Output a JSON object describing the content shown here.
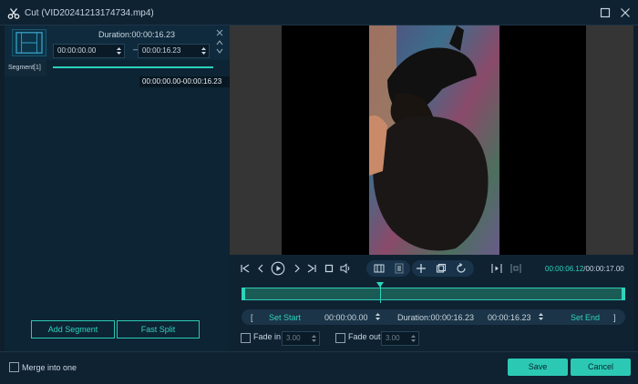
{
  "window": {
    "title": "Cut (VID20241213174734.mp4)",
    "icons": {
      "app": "scissors-icon",
      "maximize": "maximize-icon",
      "close": "close-icon"
    }
  },
  "segment_panel": {
    "duration_text": "Duration:00:00:16.23",
    "start_time": "00:00:00.00",
    "end_time": "00:00:16.23",
    "segment_label": "Segment[1]",
    "segment_range": "00:00:00.00-00:00:16.23",
    "add_segment_label": "Add Segment",
    "fast_split_label": "Fast Split"
  },
  "player": {
    "current_time": "00:00:06.12",
    "total_time": "/00:00:17.00",
    "playhead_fraction": 0.36
  },
  "trim_bar": {
    "open_bracket": "[",
    "set_start_label": "Set Start",
    "start_value": "00:00:00.00",
    "duration_text": "Duration:00:00:16.23",
    "end_value": "00:00:16.23",
    "set_end_label": "Set End",
    "close_bracket": "]"
  },
  "fade": {
    "fade_in_label": "Fade in",
    "fade_in_value": "3.00",
    "fade_out_label": "Fade out",
    "fade_out_value": "3.00"
  },
  "footer": {
    "merge_label": "Merge into one",
    "save_label": "Save",
    "cancel_label": "Cancel"
  },
  "colors": {
    "accent": "#2bc9b3",
    "panel": "#0f2232",
    "background": "#0f1e2b"
  }
}
